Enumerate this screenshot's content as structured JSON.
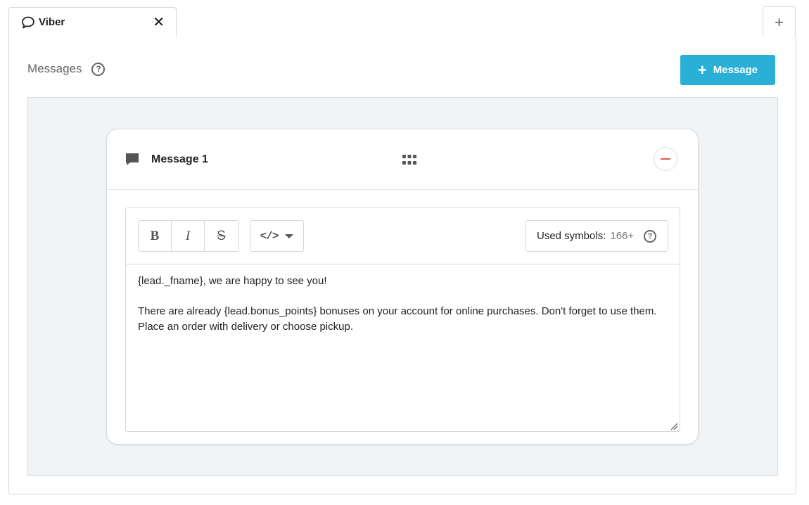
{
  "tabs": [
    {
      "label": "Viber",
      "icon": "speech-bubble-icon",
      "active": true
    }
  ],
  "tab_close_glyph": "✕",
  "add_tab_glyph": "+",
  "section": {
    "title": "Messages",
    "help_glyph": "?"
  },
  "add_message_button": {
    "plus": "+",
    "label": "Message"
  },
  "message_card": {
    "title": "Message 1",
    "toolbar": {
      "bold": "B",
      "italic": "I",
      "strike": "S",
      "code": "</>",
      "used_symbols_label": "Used symbols:",
      "used_symbols_count": "166+",
      "help_glyph": "?"
    },
    "text": {
      "line1": "{lead._fname}, we are happy to see you!",
      "line2": "There are already {lead.bonus_points} bonuses on your account for online purchases. Don't forget to use them. Place an order with delivery or choose pickup."
    }
  },
  "colors": {
    "accent": "#2ab0d6",
    "remove": "#e35a5a",
    "canvas": "#f1f4f7"
  }
}
